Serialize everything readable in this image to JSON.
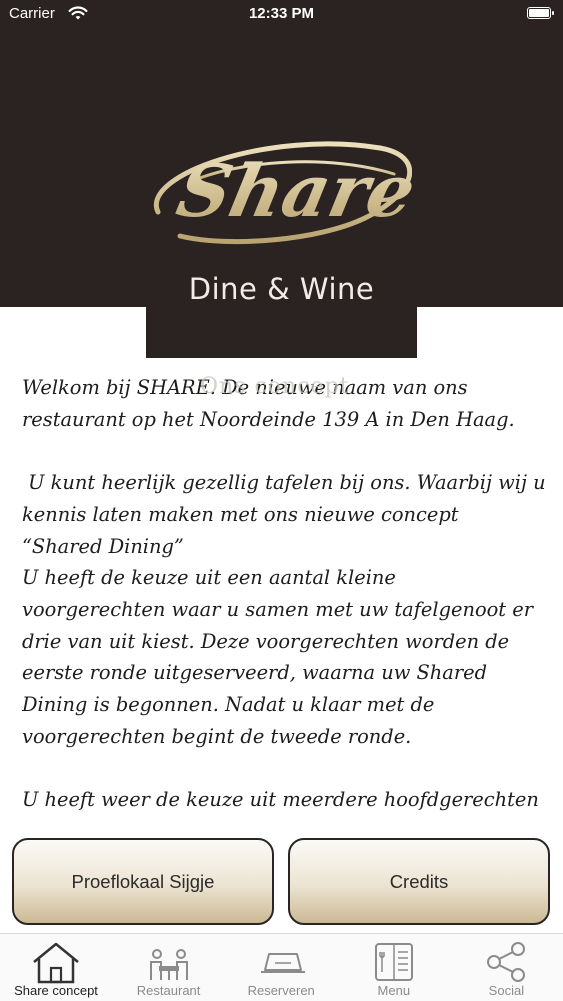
{
  "status_bar": {
    "carrier": "Carrier",
    "time": "12:33 PM"
  },
  "header": {
    "logo_text": "Share",
    "logo_subtitle": "Dine & Wine",
    "title": "Ons concept",
    "background_color": "#2b2321",
    "logo_gold": "#d8c69b"
  },
  "content": {
    "paragraphs": [
      [
        "Welkom bij SHARE. De nieuwe naam van ons",
        "restaurant op het Noordeinde 139 A in Den Haag."
      ],
      [
        " U kunt heerlijk gezellig tafelen bij ons. Waarbij wij u",
        "kennis laten maken met ons nieuwe concept",
        "“Shared Dining”",
        "U heeft de keuze uit een aantal kleine",
        "voorgerechten waar u samen met uw tafelgenoot er",
        "drie van uit kiest. Deze voorgerechten worden de",
        "eerste ronde uitgeserveerd, waarna uw Shared",
        "Dining is begonnen. Nadat u klaar met de",
        "voorgerechten begint de tweede ronde."
      ],
      [
        "U heeft weer de keuze uit meerdere hoofdgerechten"
      ]
    ]
  },
  "buttons": {
    "left_label": "Proeflokaal Sijgje",
    "right_label": "Credits"
  },
  "tab_bar": {
    "active_index": 0,
    "tabs": [
      {
        "label": "Share concept",
        "icon": "house-icon"
      },
      {
        "label": "Restaurant",
        "icon": "dining-table-icon"
      },
      {
        "label": "Reserveren",
        "icon": "place-card-icon"
      },
      {
        "label": "Menu",
        "icon": "menu-book-icon"
      },
      {
        "label": "Social",
        "icon": "share-icon"
      }
    ]
  }
}
